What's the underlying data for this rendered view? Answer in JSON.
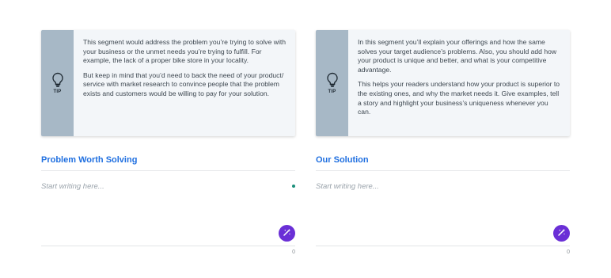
{
  "left": {
    "tip_label": "TIP",
    "tip_paragraphs": [
      "This segment would address the problem you’re trying to solve with your business or the unmet needs you’re trying to fulfill. For example, the lack of a proper bike store in your locality.",
      "But keep in mind that you’d need to back the need of your product/ service with market research to convince people that the problem exists and customers would be willing to pay for your solution."
    ],
    "section_title": "Problem Worth Solving",
    "placeholder": "Start writing here...",
    "char_count": "0"
  },
  "right": {
    "tip_label": "TIP",
    "tip_paragraphs": [
      "In this segment you’ll explain your offerings and how the same solves your target audience’s problems. Also, you should add how your product is unique and better, and what is your competitive advantage.",
      "This helps your readers understand how your product is superior to the existing ones, and why the market needs it. Give examples, tell a story and highlight your business’s uniqueness whenever you can."
    ],
    "section_title": "Our Solution",
    "placeholder": "Start writing here...",
    "char_count": "0"
  },
  "icons": {
    "tip": "lightbulb-icon",
    "ai_button": "magic-wand-icon"
  },
  "colors": {
    "accent_title": "#1f6fe0",
    "tip_sidebar": "#a7b8c6",
    "ai_button": "#6a2fd6",
    "status_dot": "#1a8f7a"
  }
}
